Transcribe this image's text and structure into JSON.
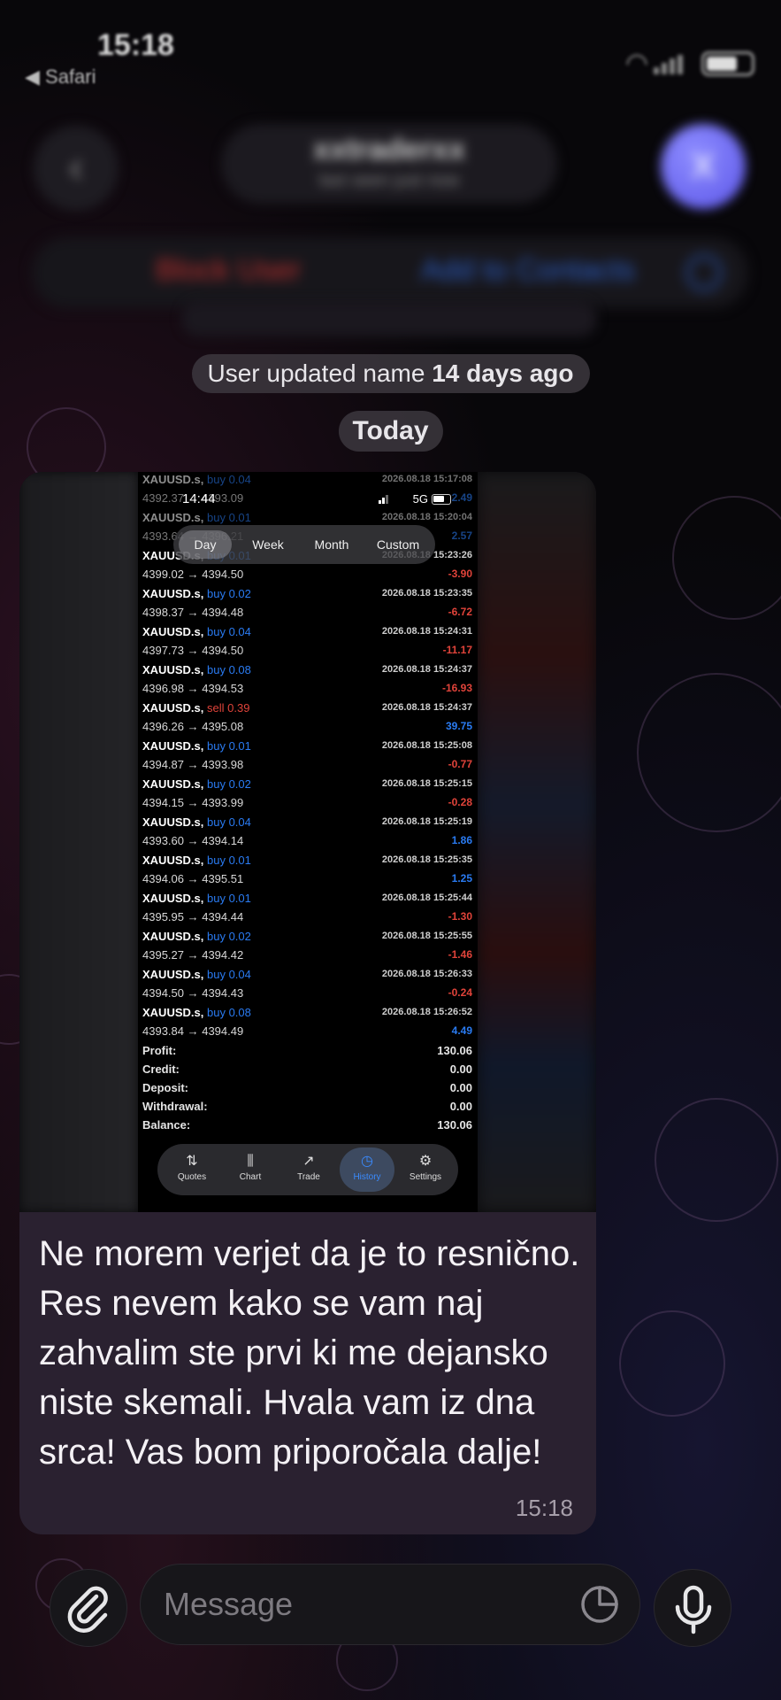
{
  "status_bar": {
    "time": "15:18",
    "back_app": "◀ Safari"
  },
  "header": {
    "back_icon": "chevron-left-icon",
    "name": "xxtraderxx",
    "subtitle": "last seen just now",
    "avatar_letter": "X"
  },
  "action_bar": {
    "block_label": "Block User",
    "add_contact_label": "Add to Contacts"
  },
  "service": {
    "name_update_prefix": "User updated name ",
    "name_update_bold": "14 days ago",
    "date_separator": "Today"
  },
  "screenshot": {
    "time": "14:44",
    "network": "5G",
    "segments": [
      "Day",
      "Week",
      "Month",
      "Custom"
    ],
    "active_segment": "Day",
    "trades": [
      {
        "symbol": "XAUUSD.s,",
        "side": "buy",
        "volume": "0.04",
        "date": "2026.08.18 15:17:08",
        "prices": "4392.37 → 4393.09",
        "pl": "2.49",
        "sign": "pos"
      },
      {
        "symbol": "XAUUSD.s,",
        "side": "buy",
        "volume": "0.01",
        "date": "2026.08.18 15:20:04",
        "prices": "4393.64 → 4396.21",
        "pl": "2.57",
        "sign": "pos"
      },
      {
        "symbol": "XAUUSD.s,",
        "side": "buy",
        "volume": "0.01",
        "date": "2026.08.18 15:23:26",
        "prices": "4399.02 → 4394.50",
        "pl": "-3.90",
        "sign": "neg"
      },
      {
        "symbol": "XAUUSD.s,",
        "side": "buy",
        "volume": "0.02",
        "date": "2026.08.18 15:23:35",
        "prices": "4398.37 → 4394.48",
        "pl": "-6.72",
        "sign": "neg"
      },
      {
        "symbol": "XAUUSD.s,",
        "side": "buy",
        "volume": "0.04",
        "date": "2026.08.18 15:24:31",
        "prices": "4397.73 → 4394.50",
        "pl": "-11.17",
        "sign": "neg"
      },
      {
        "symbol": "XAUUSD.s,",
        "side": "buy",
        "volume": "0.08",
        "date": "2026.08.18 15:24:37",
        "prices": "4396.98 → 4394.53",
        "pl": "-16.93",
        "sign": "neg"
      },
      {
        "symbol": "XAUUSD.s,",
        "side": "sell",
        "volume": "0.39",
        "date": "2026.08.18 15:24:37",
        "prices": "4396.26 → 4395.08",
        "pl": "39.75",
        "sign": "pos"
      },
      {
        "symbol": "XAUUSD.s,",
        "side": "buy",
        "volume": "0.01",
        "date": "2026.08.18 15:25:08",
        "prices": "4394.87 → 4393.98",
        "pl": "-0.77",
        "sign": "neg"
      },
      {
        "symbol": "XAUUSD.s,",
        "side": "buy",
        "volume": "0.02",
        "date": "2026.08.18 15:25:15",
        "prices": "4394.15 → 4393.99",
        "pl": "-0.28",
        "sign": "neg"
      },
      {
        "symbol": "XAUUSD.s,",
        "side": "buy",
        "volume": "0.04",
        "date": "2026.08.18 15:25:19",
        "prices": "4393.60 → 4394.14",
        "pl": "1.86",
        "sign": "pos"
      },
      {
        "symbol": "XAUUSD.s,",
        "side": "buy",
        "volume": "0.01",
        "date": "2026.08.18 15:25:35",
        "prices": "4394.06 → 4395.51",
        "pl": "1.25",
        "sign": "pos"
      },
      {
        "symbol": "XAUUSD.s,",
        "side": "buy",
        "volume": "0.01",
        "date": "2026.08.18 15:25:44",
        "prices": "4395.95 → 4394.44",
        "pl": "-1.30",
        "sign": "neg"
      },
      {
        "symbol": "XAUUSD.s,",
        "side": "buy",
        "volume": "0.02",
        "date": "2026.08.18 15:25:55",
        "prices": "4395.27 → 4394.42",
        "pl": "-1.46",
        "sign": "neg"
      },
      {
        "symbol": "XAUUSD.s,",
        "side": "buy",
        "volume": "0.04",
        "date": "2026.08.18 15:26:33",
        "prices": "4394.50 → 4394.43",
        "pl": "-0.24",
        "sign": "neg"
      },
      {
        "symbol": "XAUUSD.s,",
        "side": "buy",
        "volume": "0.08",
        "date": "2026.08.18 15:26:52",
        "prices": "4393.84 → 4394.49",
        "pl": "4.49",
        "sign": "pos"
      }
    ],
    "summary": [
      {
        "label": "Profit:",
        "value": "130.06"
      },
      {
        "label": "Credit:",
        "value": "0.00"
      },
      {
        "label": "Deposit:",
        "value": "0.00"
      },
      {
        "label": "Withdrawal:",
        "value": "0.00"
      },
      {
        "label": "Balance:",
        "value": "130.06"
      }
    ],
    "tabs": [
      {
        "label": "Quotes",
        "icon": "quotes-icon",
        "glyph": "⇅"
      },
      {
        "label": "Chart",
        "icon": "chart-icon",
        "glyph": "⫼"
      },
      {
        "label": "Trade",
        "icon": "trade-icon",
        "glyph": "↗"
      },
      {
        "label": "History",
        "icon": "history-icon",
        "glyph": "◷"
      },
      {
        "label": "Settings",
        "icon": "settings-icon",
        "glyph": "⚙"
      }
    ],
    "active_tab": "History"
  },
  "message": {
    "text": "Ne morem verjet da je to resnično. Res nevem kako se vam naj zahvalim ste prvi ki me dejansko niste skemali. Hvala vam iz dna srca! Vas bom priporočala dalje!",
    "time": "15:18"
  },
  "composer": {
    "placeholder": "Message",
    "attach_icon": "paperclip-icon",
    "sticker_icon": "sticker-icon",
    "mic_icon": "microphone-icon"
  },
  "colors": {
    "buy": "#2a7bf2",
    "sell": "#e0433a",
    "bubble": "#2a2130",
    "active_tab": "#3a8bff"
  }
}
